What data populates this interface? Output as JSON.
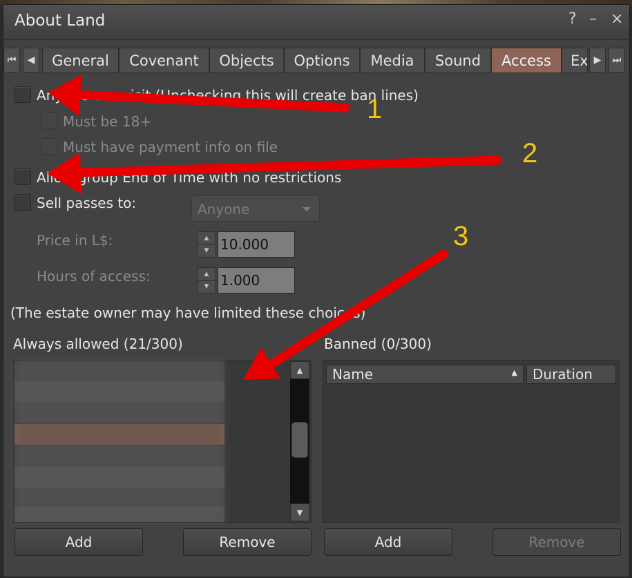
{
  "window": {
    "title": "About Land",
    "help_glyph": "?",
    "minimize_glyph": "–",
    "close_glyph": "×"
  },
  "tabs": {
    "nav_first": "⏮",
    "nav_prev": "◀",
    "nav_next": "▶",
    "nav_last": "⏭",
    "items": [
      {
        "label": "General"
      },
      {
        "label": "Covenant"
      },
      {
        "label": "Objects"
      },
      {
        "label": "Options"
      },
      {
        "label": "Media"
      },
      {
        "label": "Sound"
      },
      {
        "label": "Access"
      },
      {
        "label": "Ex"
      }
    ],
    "active": "Access"
  },
  "access": {
    "anyone_can_visit": "Anyone can visit (Unchecking this will create ban lines)",
    "must_be_18": "Must be 18+",
    "must_have_payment": "Must have payment info on file",
    "allow_group": "Allow group End of Time with no restrictions",
    "sell_passes": "Sell passes to:",
    "sell_passes_option": "Anyone",
    "price_label": "Price in L$:",
    "price_value": "10.000",
    "hours_label": "Hours of access:",
    "hours_value": "1.000",
    "estate_note": "(The estate owner may have limited these choices)"
  },
  "allowed": {
    "heading": "Always allowed (21/300)",
    "add_label": "Add",
    "remove_label": "Remove",
    "scroll_up": "▲",
    "scroll_down": "▼"
  },
  "banned": {
    "heading": "Banned (0/300)",
    "col_name": "Name",
    "col_duration": "Duration",
    "sort_glyph": "▲",
    "add_label": "Add",
    "remove_label": "Remove"
  },
  "annotations": {
    "one": "1",
    "two": "2",
    "three": "3"
  },
  "colors": {
    "active_tab": "#8d6455",
    "selection": "#8a5a46",
    "arrow": "#e60000",
    "annotation": "#f0c419"
  }
}
